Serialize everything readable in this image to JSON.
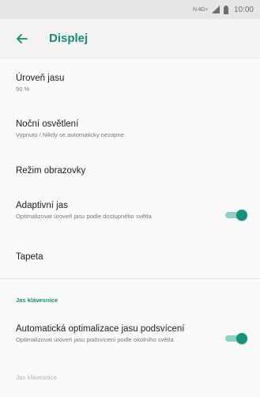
{
  "status_bar": {
    "network_text": "N 4G+",
    "time": "10:00"
  },
  "app_bar": {
    "title": "Displej"
  },
  "settings": [
    {
      "title": "Úroveň jasu",
      "summary": "50 %"
    },
    {
      "title": "Noční osvětlení",
      "summary": "Vypnuto / Nikdy se automaticky nezapne"
    },
    {
      "title": "Režim obrazovky"
    },
    {
      "title": "Adaptivní jas",
      "summary": "Optimalizovat úroveň jasu podle dostupného světla",
      "toggle_on": true
    },
    {
      "title": "Tapeta"
    }
  ],
  "section": {
    "header": "Jas klávesnice",
    "items": [
      {
        "title": "Automatická optimalizace jasu podsvícení",
        "summary": "Optimalizovat úroveň jasu podsvícení podle okolního světla",
        "toggle_on": true
      },
      {
        "title": "Jas klávesnice",
        "disabled": true
      }
    ]
  },
  "colors": {
    "accent": "#148c73",
    "toggle_thumb": "#16917a",
    "toggle_track": "#8ed2c1"
  }
}
